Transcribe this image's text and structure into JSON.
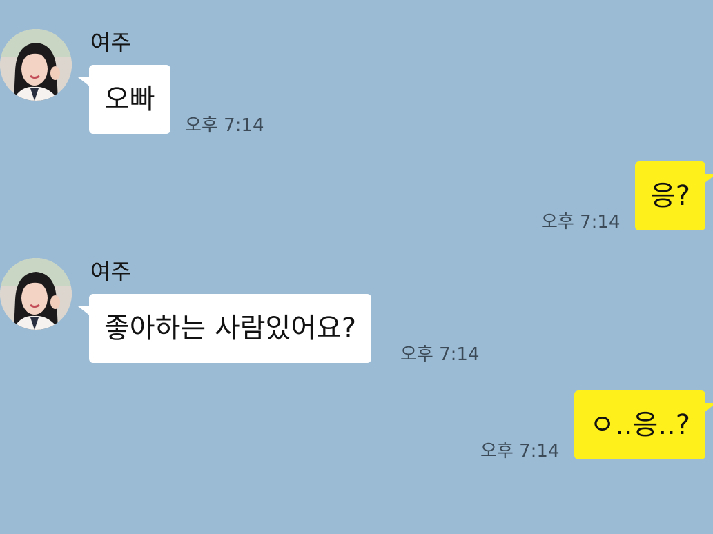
{
  "colors": {
    "background": "#9bbbd4",
    "received_bubble": "#ffffff",
    "sent_bubble": "#fef01b",
    "timestamp": "#3c4a57"
  },
  "messages": [
    {
      "direction": "received",
      "sender": "여주",
      "avatar_icon": "profile-photo-icon",
      "text": "오빠",
      "time": "오후 7:14"
    },
    {
      "direction": "sent",
      "text": "응?",
      "time": "오후 7:14"
    },
    {
      "direction": "received",
      "sender": "여주",
      "avatar_icon": "profile-photo-icon",
      "text": "좋아하는 사람있어요?",
      "time": "오후 7:14"
    },
    {
      "direction": "sent",
      "text": "ㅇ..응..?",
      "time": "오후 7:14"
    }
  ]
}
